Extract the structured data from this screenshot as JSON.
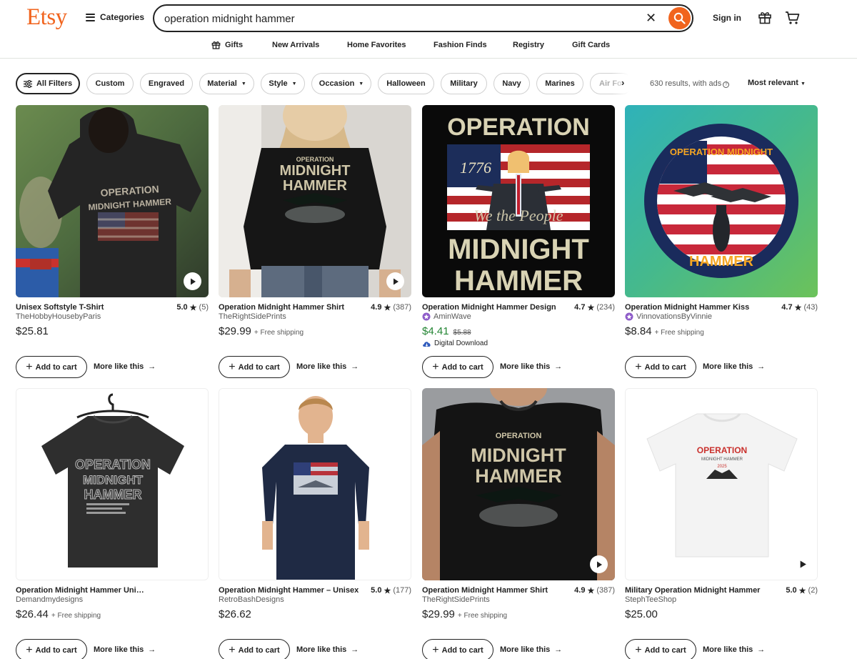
{
  "header": {
    "logo": "Etsy",
    "categories_label": "Categories",
    "search_value": "operation midnight hammer",
    "signin_label": "Sign in"
  },
  "subnav": [
    "Gifts",
    "New Arrivals",
    "Home Favorites",
    "Fashion Finds",
    "Registry",
    "Gift Cards"
  ],
  "filters": {
    "all_filters": "All Filters",
    "chips": [
      "Custom",
      "Engraved",
      "Material",
      "Style",
      "Occasion",
      "Halloween",
      "Military",
      "Navy",
      "Marines",
      "Air Fo"
    ],
    "results": "630 results, with ads",
    "sort": "Most relevant"
  },
  "actions": {
    "add_to_cart": "Add to cart",
    "more_like_this": "More like this"
  },
  "listings": [
    {
      "title": "Unisex Softstyle T-Shirt",
      "rating": "5.0",
      "count": "(5)",
      "shop": "TheHobbyHousebyParis",
      "price": "$25.81",
      "shipping": ""
    },
    {
      "title": "Operation Midnight Hammer Shirt",
      "rating": "4.9",
      "count": "(387)",
      "shop": "TheRightSidePrints",
      "price": "$29.99",
      "shipping": "+ Free shipping"
    },
    {
      "title": "Operation Midnight Hammer Design",
      "rating": "4.7",
      "count": "(234)",
      "shop": "AminWave",
      "price": "$4.41",
      "original_price": "$5.88",
      "digital": "Digital Download"
    },
    {
      "title": "Operation Midnight Hammer Kiss",
      "rating": "4.7",
      "count": "(43)",
      "shop": "VinnovationsByVinnie",
      "price": "$8.84",
      "shipping": "+ Free shipping"
    },
    {
      "title": "Operation Midnight Hammer Unisex",
      "rating": "",
      "count": "",
      "shop": "Demandmydesigns",
      "price": "$26.44",
      "shipping": "+ Free shipping"
    },
    {
      "title": "Operation Midnight Hammer – Unisex",
      "rating": "5.0",
      "count": "(177)",
      "shop": "RetroBashDesigns",
      "price": "$26.62",
      "shipping": ""
    },
    {
      "title": "Operation Midnight Hammer Shirt",
      "rating": "4.9",
      "count": "(387)",
      "shop": "TheRightSidePrints",
      "price": "$29.99",
      "shipping": "+ Free shipping"
    },
    {
      "title": "Military Operation Midnight Hammer",
      "rating": "5.0",
      "count": "(2)",
      "shop": "StephTeeShop",
      "price": "$25.00",
      "shipping": ""
    }
  ],
  "image_text": {
    "operation": "OPERATION",
    "midnight": "MIDNIGHT",
    "hammer": "HAMMER",
    "midnight_hammer_small": "MIDNIGHT HAMMER",
    "year_1776": "1776",
    "we_the_people": "We the People",
    "operation_midnight": "OPERATION MIDNIGHT",
    "year_2025": "2025"
  },
  "colors": {
    "brand": "#F1641E",
    "sale": "#258635",
    "border": "#D0D0D0",
    "text": "#222222",
    "muted": "#595959"
  }
}
